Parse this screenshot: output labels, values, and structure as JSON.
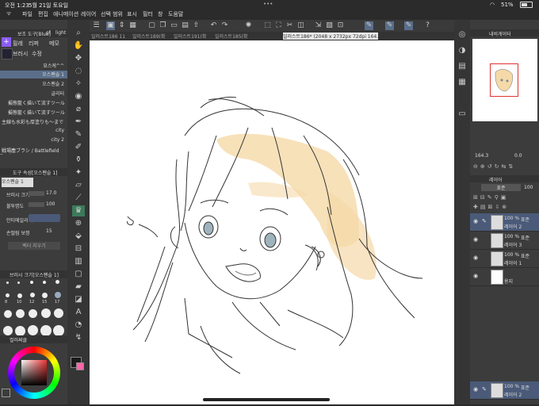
{
  "status": {
    "time": "오전 1:23",
    "date": "5월 21일 토요일",
    "battery": "51%"
  },
  "menu": [
    "파일",
    "편집",
    "애니메이션",
    "레이어",
    "선택 범위",
    "표시",
    "필터",
    "창",
    "도움말"
  ],
  "tabs": [
    {
      "label": "일러스트186 11"
    },
    {
      "label": "일러스트189(확"
    },
    {
      "label": "일러스트191(확"
    },
    {
      "label": "일러스트185(확"
    },
    {
      "label": "일러스트186* (2048 x 2732px 72dpi 164.3%)"
    }
  ],
  "brush_panel": {
    "header": "보조 도구[Blue]",
    "header2": "of",
    "header3": "light",
    "items": [
      "오스펜슬 1",
      "오스펜슬 2",
      "글리터",
      "擬態藍く描いて流すツール 参照",
      "擬態藍く描いて流すツール 参照",
      "主線も水彩も厚塗りも〜までやる主",
      "city",
      "city 2",
      "戦場塵ブラシ / Battlefield Dust"
    ],
    "header_item": "묘스케^^",
    "sub": [
      "필레",
      "리퍼",
      "메모",
      "브러시",
      "수정"
    ]
  },
  "tool_props": {
    "title": "도구 속성[오스펜슬 1]",
    "brush_name": "오스펜슬 1",
    "size_label": "브러시 크기",
    "size_value": "17.0",
    "opacity_label": "불투명도",
    "opacity_value": "100",
    "blend_label": "안티에일리어",
    "correction_label": "손떨림 보정",
    "correction_value": "15",
    "vector_label": "벡터 지우기"
  },
  "brush_size": {
    "title": "브러시 크기[오스펜슬 1]",
    "sizes": [
      "8",
      "10",
      "12",
      "15",
      "17"
    ]
  },
  "color": {
    "title": "컬러써클",
    "fg": "#1a1a1a",
    "bg": "#ffffff"
  },
  "navigator": {
    "title": "내비게이터",
    "zoom": "164.3",
    "angle": "0.0"
  },
  "layers": {
    "title": "레이어",
    "blend": "표준",
    "opacity": "100",
    "rows": [
      {
        "pct": "100 %",
        "mode": "표준",
        "name": "레이어 2"
      },
      {
        "pct": "100 %",
        "mode": "표준",
        "name": "레이어 3"
      },
      {
        "pct": "100 %",
        "mode": "표준",
        "name": "레이어 1"
      },
      {
        "pct": "",
        "mode": "",
        "name": "용지"
      }
    ],
    "bottom": {
      "pct": "100 %",
      "mode": "표준",
      "name": "레이어 2"
    }
  }
}
